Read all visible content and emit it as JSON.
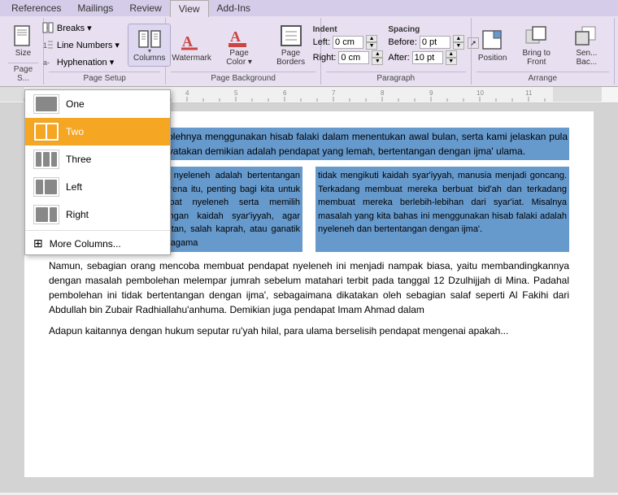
{
  "ribbon": {
    "tabs": [
      {
        "id": "references",
        "label": "References"
      },
      {
        "id": "mailings",
        "label": "Mailings"
      },
      {
        "id": "review",
        "label": "Review"
      },
      {
        "id": "view",
        "label": "View"
      },
      {
        "id": "addins",
        "label": "Add-Ins"
      }
    ],
    "active_tab": "view",
    "groups": {
      "page_setup": {
        "label": "Page Setup",
        "items": {
          "breaks": "Breaks ▾",
          "line_numbers": "Line Numbers ▾",
          "hyphenation": "Hyphenation ▾",
          "columns_label": "Columns",
          "size_label": "Size",
          "page_label": "Page S..."
        }
      },
      "page_background": {
        "label": "Page Background",
        "watermark_label": "Watermark",
        "page_color_label": "Page Color ▾",
        "page_borders_label": "Page Borders"
      },
      "paragraph": {
        "label": "Paragraph",
        "indent_label": "Indent",
        "left_label": "Left:",
        "left_value": "0 cm",
        "right_label": "Right:",
        "right_value": "0 cm",
        "spacing_label": "Spacing",
        "before_label": "Before:",
        "before_value": "0 pt",
        "after_label": "After:",
        "after_value": "10 pt"
      },
      "arrange": {
        "label": "Arrange",
        "position_label": "Position",
        "bring_to_front_label": "Bring to Front",
        "send_to_back_label": "Sen... Bac..."
      }
    }
  },
  "columns_menu": {
    "items": [
      {
        "id": "one",
        "label": "One",
        "active": false,
        "cols": 1
      },
      {
        "id": "two",
        "label": "Two",
        "active": true,
        "cols": 2
      },
      {
        "id": "three",
        "label": "Three",
        "active": false,
        "cols": 3
      },
      {
        "id": "left",
        "label": "Left",
        "active": false,
        "cols": "left"
      },
      {
        "id": "right",
        "label": "Right",
        "active": false,
        "cols": "right"
      },
      {
        "id": "more",
        "label": "More Columns...",
        "active": false
      }
    ]
  },
  "document": {
    "paragraph1": "mi jelaskan tentang tidak bolehnya menggunakan hisab falaki dalam menentukan awal bulan, serta kami jelaskan pula bahwa pendapat yang menyatakan demikian adalah pendapat yang lemah, bertentangan dengan ijma' ulama.",
    "col1_p1": "Pertama, satu ciri pendapat nyeleneh adalah bertentangan dengan ijma' ulama. Oleh karena itu, penting bagi kita untuk mengetahui ciri-ciri pendapat nyeleneh serta memilih pendapat yang sesuai dengan kaidah syar'iyyah, agar terhindar dari budaya ikut-ikutan, salah kaprah, atau ganatik golongan. Jika permasalahan agama",
    "col2_p1": "tidak mengikuti kaidah syar'iyyah, manusia menjadi goncang. Terkadang membuat mereka berbuat bid'ah dan terkadang membuat mereka berlebih-lebihan dari syar'iat. Misalnya masalah yang kita bahas ini menggunakan hisab falaki adalah nyeleneh dan bertentangan dengan ijma'.",
    "paragraph2": "Namun, sebagian orang mencoba membuat pendapat nyeleneh ini menjadi nampak biasa, yaitu membandingkannya dengan masalah pembolehan melempar jumrah sebelum matahari terbit pada tanggal 12 Dzulhijjah di Mina. Padahal pembolehan ini tidak bertentangan dengan ijma', sebagaimana dikatakan oleh sebagian salaf seperti Al Fakihi dari Abdullah bin Zubair Radhiallahu'anhuma. Demikian juga pendapat Imam Ahmad dalam",
    "paragraph3": "Adapun kaitannya dengan hukum seputar ru'yah hilal, para ulama berselisih pendapat mengenai apakah..."
  }
}
